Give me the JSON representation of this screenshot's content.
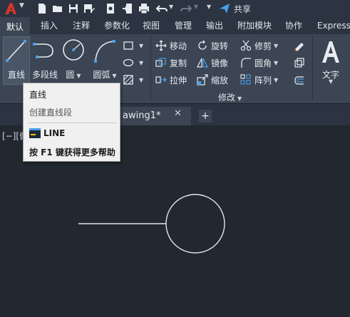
{
  "quick_access": {
    "share_label": "共享",
    "icons": [
      "new-icon",
      "open-icon",
      "save-icon",
      "save-as-icon",
      "plot-icon",
      "print-icon",
      "undo-icon",
      "redo-icon",
      "share-icon"
    ]
  },
  "tabs": [
    {
      "label": "默认",
      "active": true
    },
    {
      "label": "插入"
    },
    {
      "label": "注释"
    },
    {
      "label": "参数化"
    },
    {
      "label": "视图"
    },
    {
      "label": "管理"
    },
    {
      "label": "输出"
    },
    {
      "label": "附加模块"
    },
    {
      "label": "协作"
    },
    {
      "label": "Express"
    }
  ],
  "draw_panel": {
    "line": "直线",
    "polyline": "多段线",
    "circle": "圆",
    "arc": "圆弧"
  },
  "modify_panel": {
    "title": "修改",
    "move": "移动",
    "rotate": "旋转",
    "trim": "修剪",
    "copy": "复制",
    "mirror": "镜像",
    "fillet": "圆角",
    "stretch": "拉伸",
    "scale": "缩放",
    "array": "阵列"
  },
  "annotation_panel": {
    "text": "文字"
  },
  "file_tab": {
    "name": "awing1*",
    "close": "✕",
    "new": "+"
  },
  "viewport": {
    "label": "[−][俯"
  },
  "tooltip": {
    "title": "直线",
    "description": "创建直线段",
    "command": "LINE",
    "help": "按 F1 键获得更多帮助"
  },
  "colors": {
    "canvas": "#212830",
    "ribbon": "#3b4553",
    "toolbar": "#2b3440",
    "accent_red": "#d8342c",
    "share_blue": "#4a9fe8"
  }
}
